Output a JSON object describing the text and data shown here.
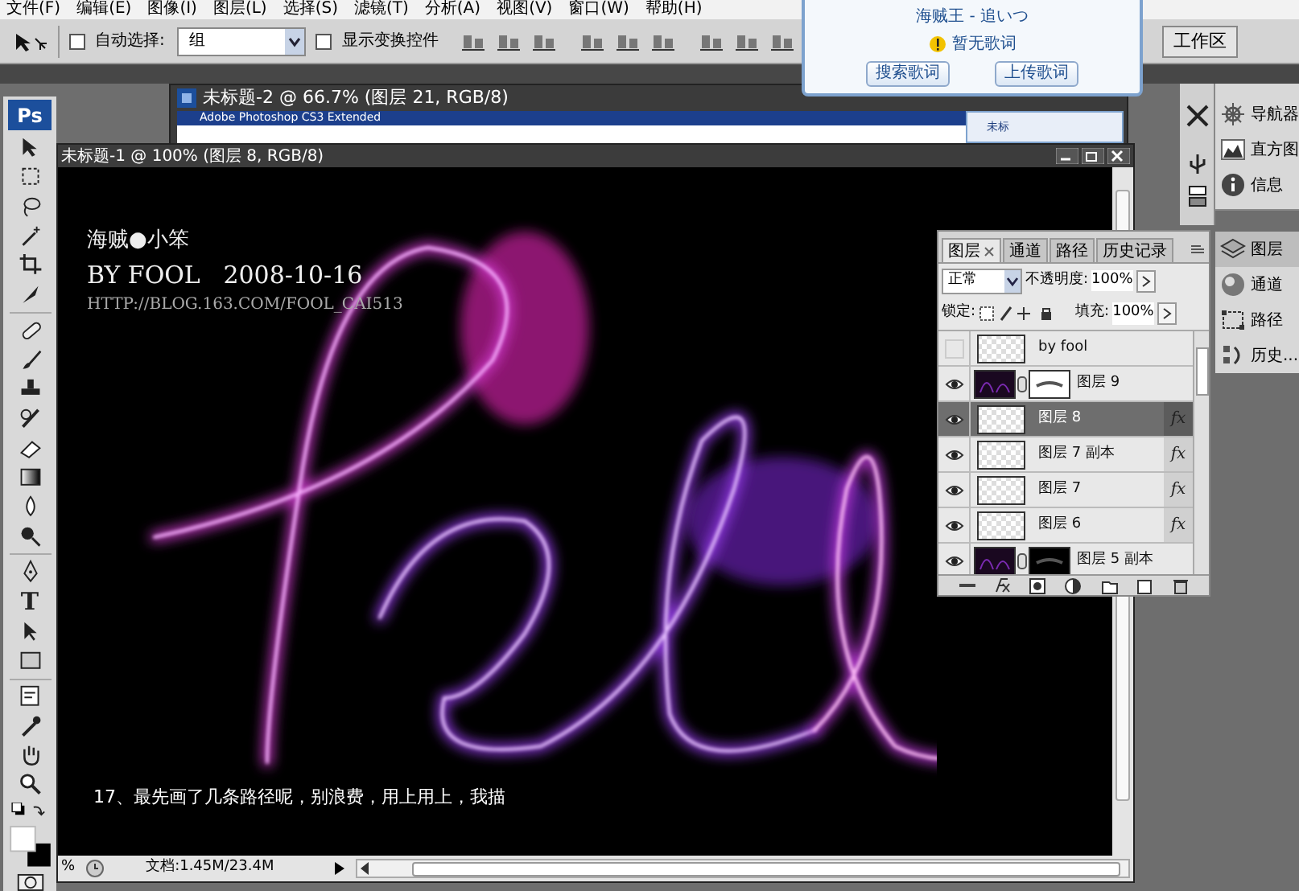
{
  "menu_bar": {
    "items": [
      "文件(F)",
      "编辑(E)",
      "图像(I)",
      "图层(L)",
      "选择(S)",
      "滤镜(T)",
      "分析(A)",
      "视图(V)",
      "窗口(W)",
      "帮助(H)"
    ]
  },
  "options_bar": {
    "auto_select": {
      "label": "自动选择:",
      "checked": false
    },
    "auto_select_mode": "组",
    "show_transform": {
      "label": "显示变换控件",
      "checked": false
    },
    "workspace": "工作区"
  },
  "lyrics_popup": {
    "song": "海贼王 - 追いつ",
    "status": "暂无歌词",
    "buttons": [
      "搜索歌词",
      "上传歌词"
    ]
  },
  "toolbox": {
    "logo": "Ps",
    "type_tool": "T"
  },
  "background_document": {
    "title": "未标题-2 @ 66.7% (图层 21, RGB/8)",
    "inner_title": "Adobe Photoshop CS3 Extended",
    "inner_panel_title": "未标"
  },
  "document": {
    "title": "未标题-1 @ 100% (图层 8, RGB/8)",
    "canvas": {
      "signature": "海贼●小笨",
      "byline": "BY FOOL   2008-10-16",
      "url": "HTTP://BLOG.163.COM/FOOL_CAI513",
      "caption": "17、最先画了几条路径呢，别浪费，用上用上，我描"
    },
    "status_bar": {
      "zoom": "%",
      "doc_info": "文档:1.45M/23.4M"
    }
  },
  "layers_panel": {
    "tabs": [
      {
        "label": "图层",
        "selected": true
      },
      {
        "label": "通道",
        "selected": false
      },
      {
        "label": "路径",
        "selected": false
      },
      {
        "label": "历史记录",
        "selected": false
      }
    ],
    "blend_mode": "正常",
    "opacity_label": "不透明度:",
    "opacity": "100%",
    "lock_label": "锁定:",
    "fill_label": "填充:",
    "fill": "100%",
    "layers": [
      {
        "name": "by fool",
        "visible": false,
        "selected": false,
        "kind": "plain"
      },
      {
        "name": "图层 9",
        "visible": true,
        "selected": false,
        "kind": "masked"
      },
      {
        "name": "图层 8",
        "visible": true,
        "selected": true,
        "fx": "fx",
        "kind": "plain"
      },
      {
        "name": "图层 7 副本",
        "visible": true,
        "selected": false,
        "fx": "fx",
        "kind": "plain"
      },
      {
        "name": "图层 7",
        "visible": true,
        "selected": false,
        "fx": "fx",
        "kind": "plain"
      },
      {
        "name": "图层 6",
        "visible": true,
        "selected": false,
        "fx": "fx",
        "kind": "plain"
      },
      {
        "name": "图层 5 副本",
        "visible": true,
        "selected": false,
        "kind": "masked"
      }
    ]
  },
  "dock": {
    "panels": [
      {
        "label": "导航器",
        "selected": false
      },
      {
        "label": "直方图",
        "selected": false
      },
      {
        "label": "信息",
        "selected": false
      },
      {
        "label": "图层",
        "selected": true
      },
      {
        "label": "通道",
        "selected": false
      },
      {
        "label": "路径",
        "selected": false
      },
      {
        "label": "历史...",
        "selected": false
      }
    ]
  }
}
